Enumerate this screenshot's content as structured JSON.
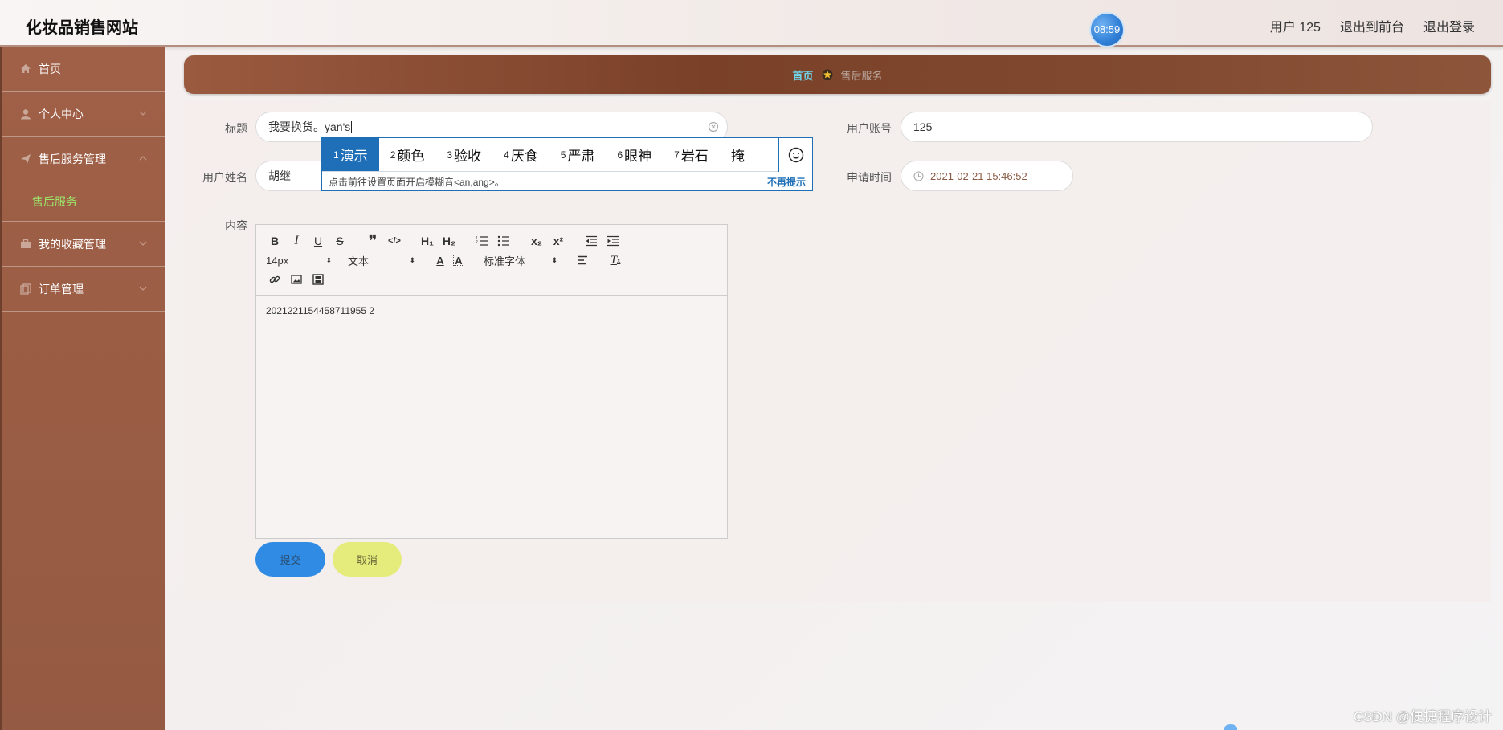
{
  "header": {
    "site_title": "化妆品销售网站",
    "clock": "08:59",
    "user_label": "用户 125",
    "to_front": "退出到前台",
    "logout": "退出登录"
  },
  "sidebar": {
    "items": [
      {
        "label": "首页",
        "icon": "home-icon"
      },
      {
        "label": "个人中心",
        "icon": "user-icon"
      },
      {
        "label": "售后服务管理",
        "icon": "send-icon"
      },
      {
        "label": "我的收藏管理",
        "icon": "briefcase-icon"
      },
      {
        "label": "订单管理",
        "icon": "copy-icon"
      }
    ],
    "sub_item": "售后服务"
  },
  "breadcrumb": {
    "home": "首页",
    "current": "售后服务"
  },
  "form": {
    "title_label": "标题",
    "title_value": "我要换货。yan's",
    "account_label": "用户账号",
    "account_value": "125",
    "name_label": "用户姓名",
    "name_value": "胡继",
    "time_label": "申请时间",
    "time_value": "2021-02-21 15:46:52",
    "content_label": "内容",
    "content_value": "2021221154458711955 2"
  },
  "ime": {
    "candidates": [
      {
        "n": "1",
        "text": "演示"
      },
      {
        "n": "2",
        "text": "颜色"
      },
      {
        "n": "3",
        "text": "验收"
      },
      {
        "n": "4",
        "text": "厌食"
      },
      {
        "n": "5",
        "text": "严肃"
      },
      {
        "n": "6",
        "text": "眼神"
      },
      {
        "n": "7",
        "text": "岩石"
      },
      {
        "n": "",
        "text": "掩"
      }
    ],
    "tip": "点击前往设置页面开启模糊音<an,ang>。",
    "no_tip": "不再提示"
  },
  "editor": {
    "font_size": "14px",
    "block_type": "文本",
    "font_family": "标准字体",
    "h1": "H₁",
    "h2": "H₂"
  },
  "buttons": {
    "submit": "提交",
    "cancel": "取消"
  },
  "watermark": "CSDN @便捷程序设计"
}
